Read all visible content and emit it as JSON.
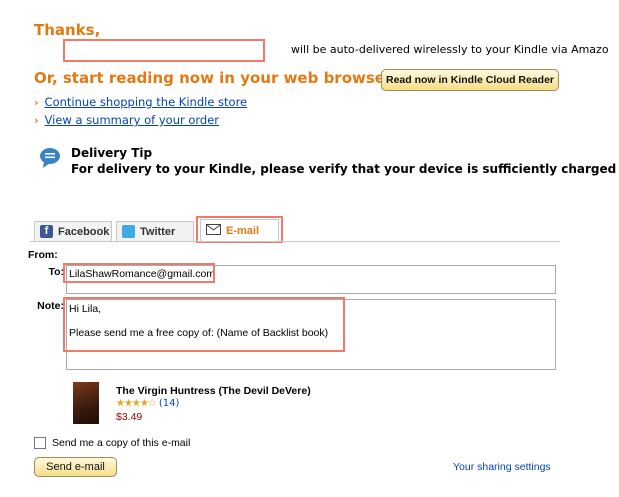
{
  "header": {
    "thanks": "Thanks,",
    "delivered_text": "will be auto-delivered wirelessly to your Kindle via Amazo",
    "browser_heading": "Or, start reading now in your web browser:",
    "cloud_reader_button": "Read now in Kindle Cloud Reader"
  },
  "links": [
    {
      "label": "Continue shopping the Kindle store"
    },
    {
      "label": "View a summary of your order"
    }
  ],
  "tip": {
    "title": "Delivery Tip",
    "body": "For delivery to your Kindle, please verify that your device is sufficiently charged and"
  },
  "share": {
    "tabs": [
      {
        "label": "Facebook",
        "icon": "facebook-icon"
      },
      {
        "label": "Twitter",
        "icon": "twitter-icon"
      },
      {
        "label": "E-mail",
        "icon": "envelope-icon"
      }
    ],
    "from_label": "From:",
    "to_label": "To:",
    "to_value": "LilaShawRomance@gmail.com",
    "note_label": "Note:",
    "note_line1": "Hi Lila,",
    "note_line2": "Please send me a free copy of:  (Name of Backlist book)"
  },
  "product": {
    "title": "The Virgin Huntress (The Devil DeVere)",
    "stars": "★★★★☆",
    "rating_count": "(14)",
    "price": "$3.49"
  },
  "copy_checkbox_label": "Send me a copy of this e-mail",
  "send_button": "Send e-mail",
  "sharing_settings": "Your sharing settings",
  "colors": {
    "accent": "#e47911",
    "link": "#0645ad",
    "annotation": "#f07a6a",
    "price": "#990000"
  }
}
